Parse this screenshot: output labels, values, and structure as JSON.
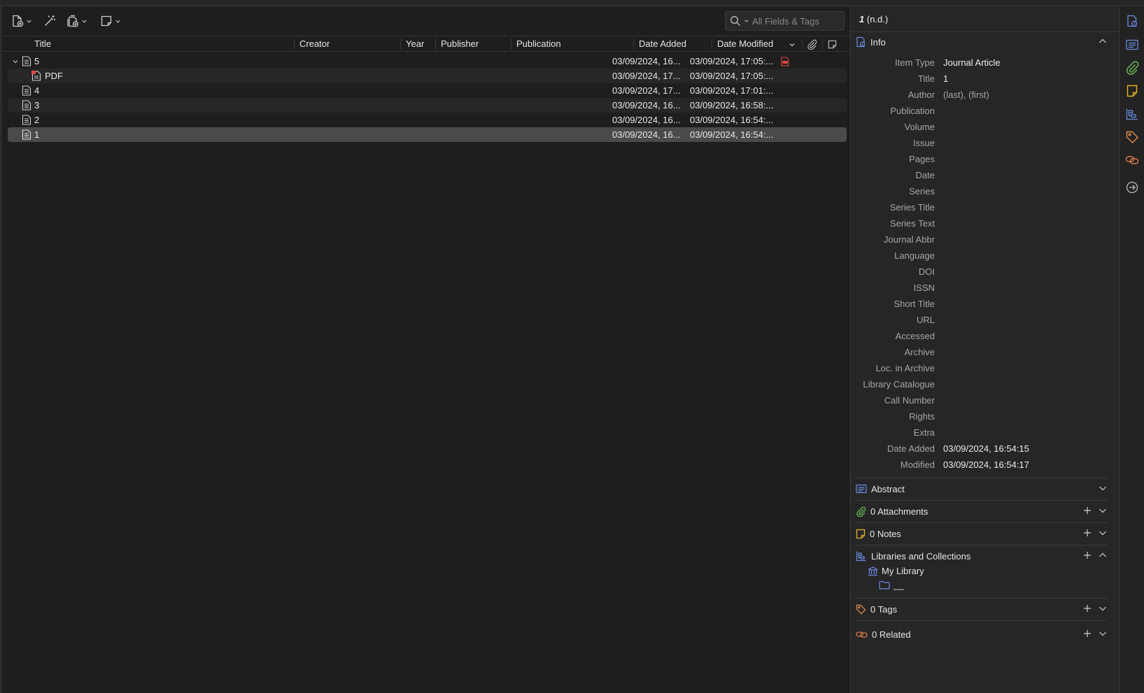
{
  "toolbar": {
    "new_item_icon": "new-item-icon",
    "add_by_identifier_icon": "magic-wand-icon",
    "add_attachment_icon": "attachment-add-icon",
    "new_note_icon": "note-add-icon",
    "search_placeholder": "All Fields & Tags"
  },
  "columns": [
    {
      "key": "title",
      "label": "Title"
    },
    {
      "key": "creator",
      "label": "Creator"
    },
    {
      "key": "year",
      "label": "Year"
    },
    {
      "key": "publisher",
      "label": "Publisher"
    },
    {
      "key": "publication",
      "label": "Publication"
    },
    {
      "key": "date_added",
      "label": "Date Added"
    },
    {
      "key": "date_modified",
      "label": "Date Modified"
    }
  ],
  "rows": [
    {
      "title": "5",
      "date_added": "03/09/2024, 16...",
      "date_modified": "03/09/2024, 17:05:...",
      "type": "document",
      "expanded": true,
      "has_pdf": true
    },
    {
      "title": "PDF",
      "date_added": "03/09/2024, 17...",
      "date_modified": "03/09/2024, 17:05:...",
      "type": "pdf",
      "child": true
    },
    {
      "title": "4",
      "date_added": "03/09/2024, 17...",
      "date_modified": "03/09/2024, 17:01:...",
      "type": "document"
    },
    {
      "title": "3",
      "date_added": "03/09/2024, 16...",
      "date_modified": "03/09/2024, 16:58:...",
      "type": "document"
    },
    {
      "title": "2",
      "date_added": "03/09/2024, 16...",
      "date_modified": "03/09/2024, 16:54:...",
      "type": "document"
    },
    {
      "title": "1",
      "date_added": "03/09/2024, 16...",
      "date_modified": "03/09/2024, 16:54:...",
      "type": "document",
      "selected": true
    }
  ],
  "item_pane": {
    "header_title": "1",
    "header_suffix": "(n.d.)",
    "info": {
      "heading": "Info",
      "fields": [
        {
          "label": "Item Type",
          "value": "Journal Article"
        },
        {
          "label": "Title",
          "value": "1"
        },
        {
          "label": "Author",
          "value": "(last), (first)"
        },
        {
          "label": "Publication",
          "value": ""
        },
        {
          "label": "Volume",
          "value": ""
        },
        {
          "label": "Issue",
          "value": ""
        },
        {
          "label": "Pages",
          "value": ""
        },
        {
          "label": "Date",
          "value": ""
        },
        {
          "label": "Series",
          "value": ""
        },
        {
          "label": "Series Title",
          "value": ""
        },
        {
          "label": "Series Text",
          "value": ""
        },
        {
          "label": "Journal Abbr",
          "value": ""
        },
        {
          "label": "Language",
          "value": ""
        },
        {
          "label": "DOI",
          "value": ""
        },
        {
          "label": "ISSN",
          "value": ""
        },
        {
          "label": "Short Title",
          "value": ""
        },
        {
          "label": "URL",
          "value": ""
        },
        {
          "label": "Accessed",
          "value": ""
        },
        {
          "label": "Archive",
          "value": ""
        },
        {
          "label": "Loc. in Archive",
          "value": ""
        },
        {
          "label": "Library Catalogue",
          "value": ""
        },
        {
          "label": "Call Number",
          "value": ""
        },
        {
          "label": "Rights",
          "value": ""
        },
        {
          "label": "Extra",
          "value": ""
        },
        {
          "label": "Date Added",
          "value": "03/09/2024, 16:54:15"
        },
        {
          "label": "Modified",
          "value": "03/09/2024, 16:54:17"
        }
      ]
    },
    "abstract": {
      "heading": "Abstract"
    },
    "attachments": {
      "heading": "0 Attachments"
    },
    "notes": {
      "heading": "0 Notes"
    },
    "libraries": {
      "heading": "Libraries and Collections",
      "library": "My Library",
      "collection": "__"
    },
    "tags": {
      "heading": "0 Tags"
    },
    "related": {
      "heading": "0 Related"
    }
  },
  "colors": {
    "background": "#1e1e1e",
    "selection": "#4a4a4a",
    "info_blue": "#6b8de3",
    "attachments_green": "#6ebf5a",
    "notes_yellow": "#e4b32a",
    "tags_orange": "#e38a4a",
    "related_orange": "#d9794a",
    "pdf_red": "#e04848"
  }
}
